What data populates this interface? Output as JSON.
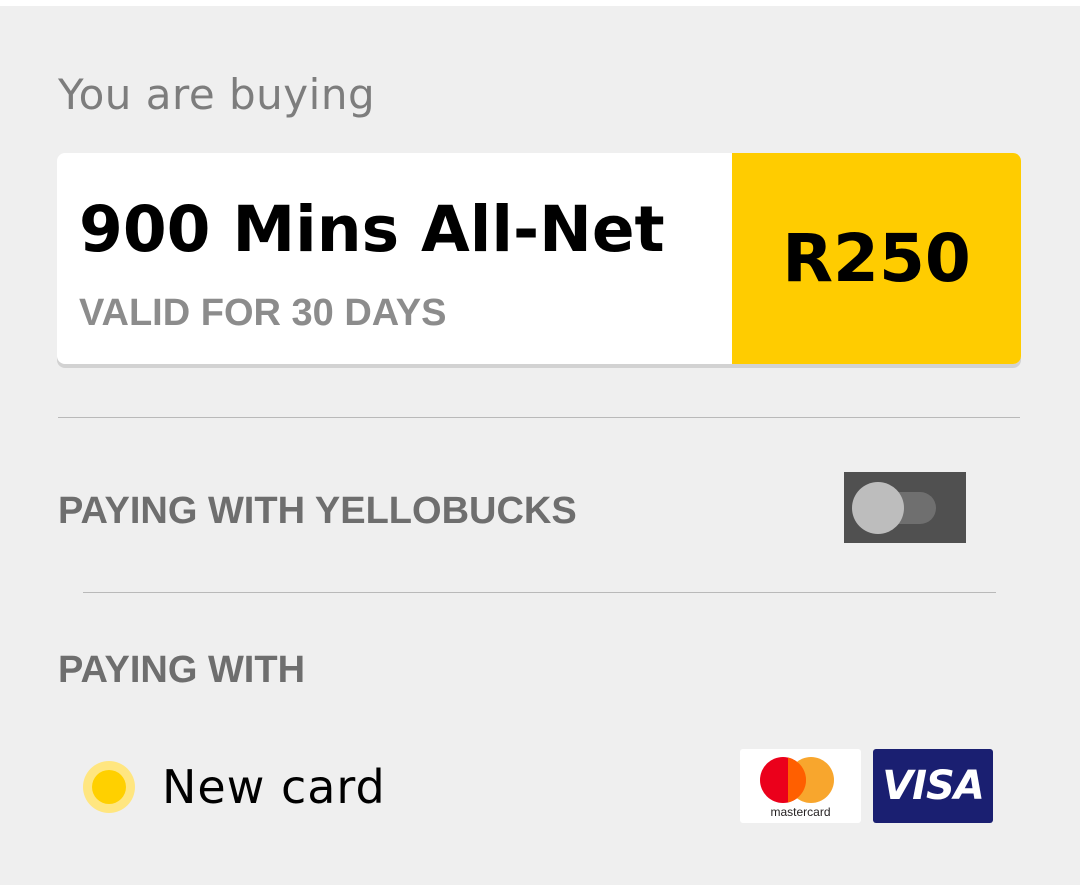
{
  "intro": {
    "text": "You are buying"
  },
  "product": {
    "name": "900 Mins All-Net",
    "validity": "VALID FOR 30 DAYS",
    "price": "R250"
  },
  "yellobucks": {
    "label": "PAYING WITH YELLOBUCKS",
    "enabled": false
  },
  "payment": {
    "label": "PAYING WITH",
    "options": [
      {
        "label": "New card",
        "selected": true
      }
    ],
    "card_brands": [
      {
        "name": "mastercard",
        "text": "mastercard"
      },
      {
        "name": "visa",
        "text": "VISA"
      }
    ]
  },
  "colors": {
    "accent": "#ffcc00",
    "background": "#efefef",
    "visa_blue": "#1a1f71"
  }
}
